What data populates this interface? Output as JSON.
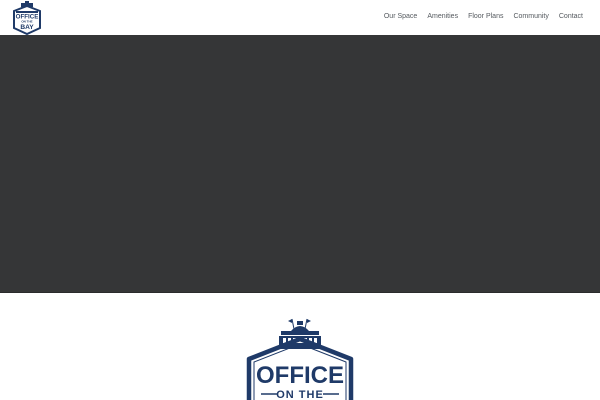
{
  "header": {
    "logo": {
      "icon": "office-on-the-bay-logo",
      "line1": "OFFICE",
      "line2": "ON THE",
      "line3": "BAY",
      "color": "#1f3a68"
    },
    "nav": [
      {
        "label": "Our Space"
      },
      {
        "label": "Amenities"
      },
      {
        "label": "Floor Plans"
      },
      {
        "label": "Community"
      },
      {
        "label": "Contact"
      }
    ]
  },
  "hero": {
    "background_color": "#353637"
  },
  "feature_logo": {
    "icon": "office-on-the-bay-logo",
    "line1": "OFFICE",
    "line2": "ON THE",
    "color": "#1f3a68"
  }
}
